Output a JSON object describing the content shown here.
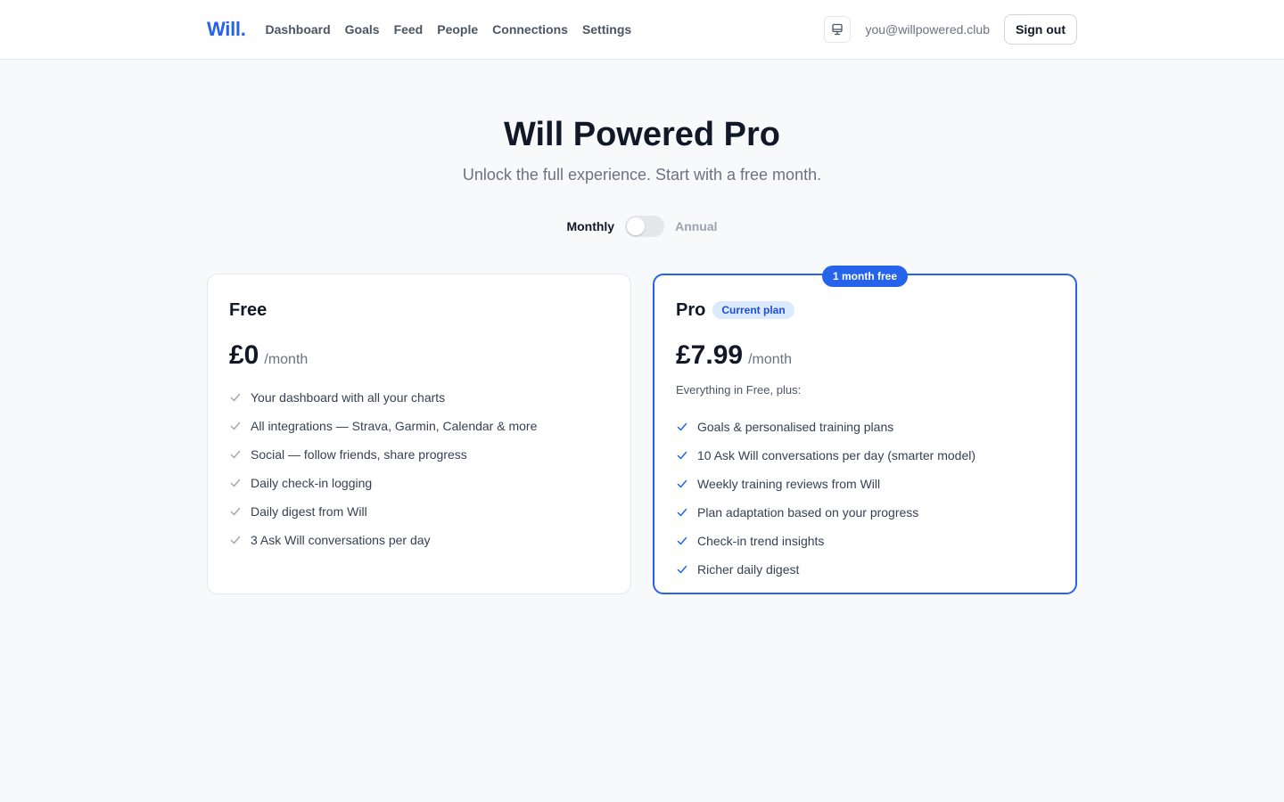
{
  "nav": {
    "logo": "Will.",
    "links": [
      "Dashboard",
      "Goals",
      "Feed",
      "People",
      "Connections",
      "Settings"
    ],
    "theme_icon": "monitor-icon",
    "email": "you@willpowered.club",
    "signout_label": "Sign out"
  },
  "hero": {
    "title": "Will Powered Pro",
    "subtitle": "Unlock the full experience. Start with a free month."
  },
  "billing_toggle": {
    "monthly_label": "Monthly",
    "annual_label": "Annual",
    "selected": "Monthly"
  },
  "plans": {
    "free": {
      "name": "Free",
      "price": "£0",
      "period": "/month",
      "features": [
        "Your dashboard with all your charts",
        "All integrations — Strava, Garmin, Calendar & more",
        "Social — follow friends, share progress",
        "Daily check-in logging",
        "Daily digest from Will",
        "3 Ask Will conversations per day"
      ]
    },
    "pro": {
      "ribbon": "1 month free",
      "name": "Pro",
      "badge": "Current plan",
      "price": "£7.99",
      "period": "/month",
      "intro": "Everything in Free, plus:",
      "features": [
        "Goals & personalised training plans",
        "10 Ask Will conversations per day (smarter model)",
        "Weekly training reviews from Will",
        "Plan adaptation based on your progress",
        "Check-in trend insights",
        "Richer daily digest"
      ]
    }
  },
  "colors": {
    "accent": "#2563eb",
    "check_free": "#9ca3af",
    "check_pro": "#2563eb"
  }
}
